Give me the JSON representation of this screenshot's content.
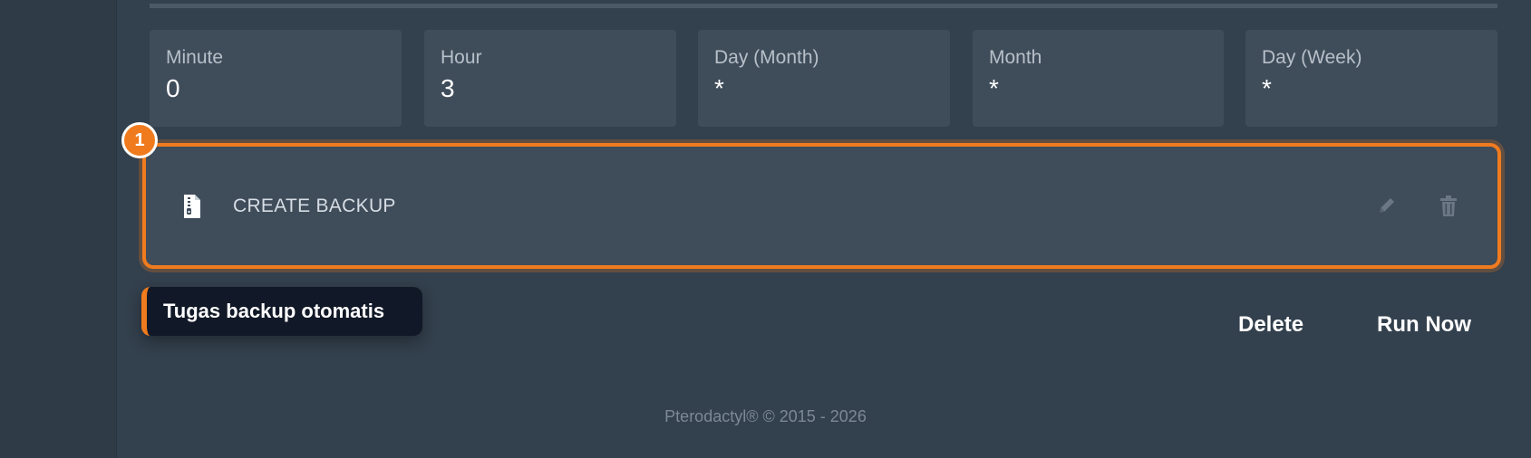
{
  "schedule": {
    "cron": [
      {
        "label": "Minute",
        "value": "0"
      },
      {
        "label": "Hour",
        "value": "3"
      },
      {
        "label": "Day (Month)",
        "value": "*"
      },
      {
        "label": "Month",
        "value": "*"
      },
      {
        "label": "Day (Week)",
        "value": "*"
      }
    ],
    "task": {
      "label": "CREATE BACKUP",
      "icon": "file-archive-icon"
    }
  },
  "tour": {
    "step_number": "1",
    "tooltip_text": "Tugas backup otomatis",
    "accent_color": "#f07b1f"
  },
  "actions": {
    "delete_label": "Delete",
    "run_now_label": "Run Now"
  },
  "footer": {
    "copyright": "Pterodactyl® © 2015 - 2026"
  }
}
